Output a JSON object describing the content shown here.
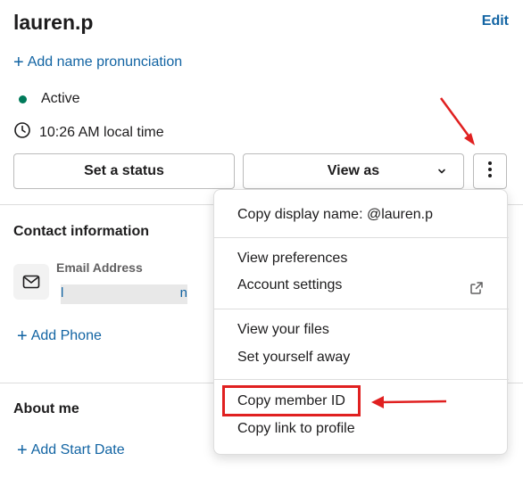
{
  "profile": {
    "name": "lauren.p",
    "edit_label": "Edit",
    "add_pronunciation_label": "Add name pronunciation",
    "status": "Active",
    "local_time": "10:26 AM local time"
  },
  "actions": {
    "set_status_label": "Set a status",
    "view_as_label": "View as"
  },
  "contact": {
    "title": "Contact information",
    "email_label": "Email Address",
    "email_value_start": "l",
    "email_value_end": "n",
    "add_phone_label": "Add Phone"
  },
  "about": {
    "title": "About me",
    "add_start_date_label": "Add Start Date"
  },
  "menu": {
    "copy_display_name": "Copy display name: @lauren.p",
    "view_preferences": "View preferences",
    "account_settings": "Account settings",
    "view_files": "View your files",
    "set_away": "Set yourself away",
    "copy_member_id": "Copy member ID",
    "copy_link": "Copy link to profile"
  },
  "colors": {
    "link": "#1264a3",
    "active": "#007a5a",
    "annotation": "#e02020"
  },
  "icons": {
    "clock": "clock-icon",
    "mail": "mail-icon",
    "more": "more-vertical-icon",
    "chevron": "chevron-down-icon",
    "external": "external-link-icon"
  }
}
